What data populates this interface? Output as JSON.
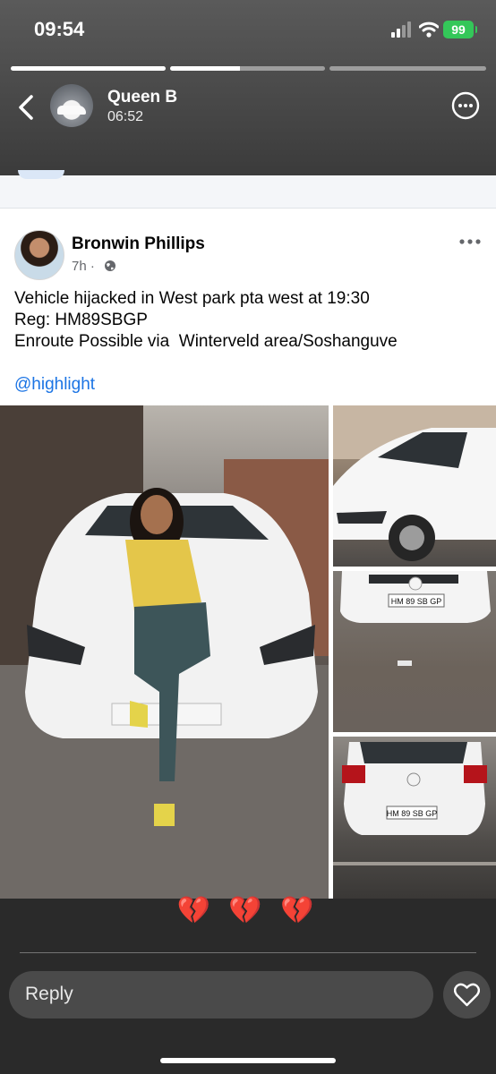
{
  "status_bar": {
    "time": "09:54",
    "battery": "99"
  },
  "story": {
    "progress": [
      1.0,
      0.45,
      0.0
    ],
    "poster_name": "Queen B",
    "posted_time": "06:52"
  },
  "post": {
    "author": "Bronwin Phillips",
    "age": "7h ·",
    "lines": [
      "Vehicle hijacked in West park pta west at 19:30",
      "Reg: HM89SBGP",
      "Enroute Possible via  Winterveld area/Soshanguve"
    ],
    "mention": "@highlight",
    "plates": [
      "HM 89 SB GP",
      "HM 89 SB GP"
    ]
  },
  "reactions": "💔 💔 💔",
  "reply": {
    "placeholder": "Reply"
  },
  "colors": {
    "accent": "#1b74e4",
    "battery": "#34c759",
    "reaction": "#e23b3b"
  },
  "icons": [
    "back-icon",
    "more-icon",
    "globe-icon",
    "post-more-icon",
    "heart-icon",
    "signal-icon",
    "wifi-icon"
  ]
}
